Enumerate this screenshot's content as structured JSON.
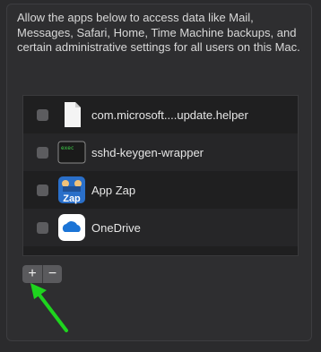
{
  "description": "Allow the apps below to access data like Mail, Messages, Safari, Home, Time Machine backups, and certain administrative settings for all users on this Mac.",
  "apps": [
    {
      "label": "com.microsoft....update.helper",
      "icon": "document-icon",
      "checked": false
    },
    {
      "label": "sshd-keygen-wrapper",
      "icon": "terminal-icon",
      "checked": false
    },
    {
      "label": "App Zap",
      "icon": "app-zap-icon",
      "checked": false
    },
    {
      "label": "OneDrive",
      "icon": "onedrive-cloud-icon",
      "checked": false
    }
  ],
  "controls": {
    "add_label": "+",
    "remove_label": "−"
  },
  "app_zap_icon_text": "Zap",
  "colors": {
    "arrow": "#1ed41e",
    "onedrive": "#1b74d6"
  }
}
